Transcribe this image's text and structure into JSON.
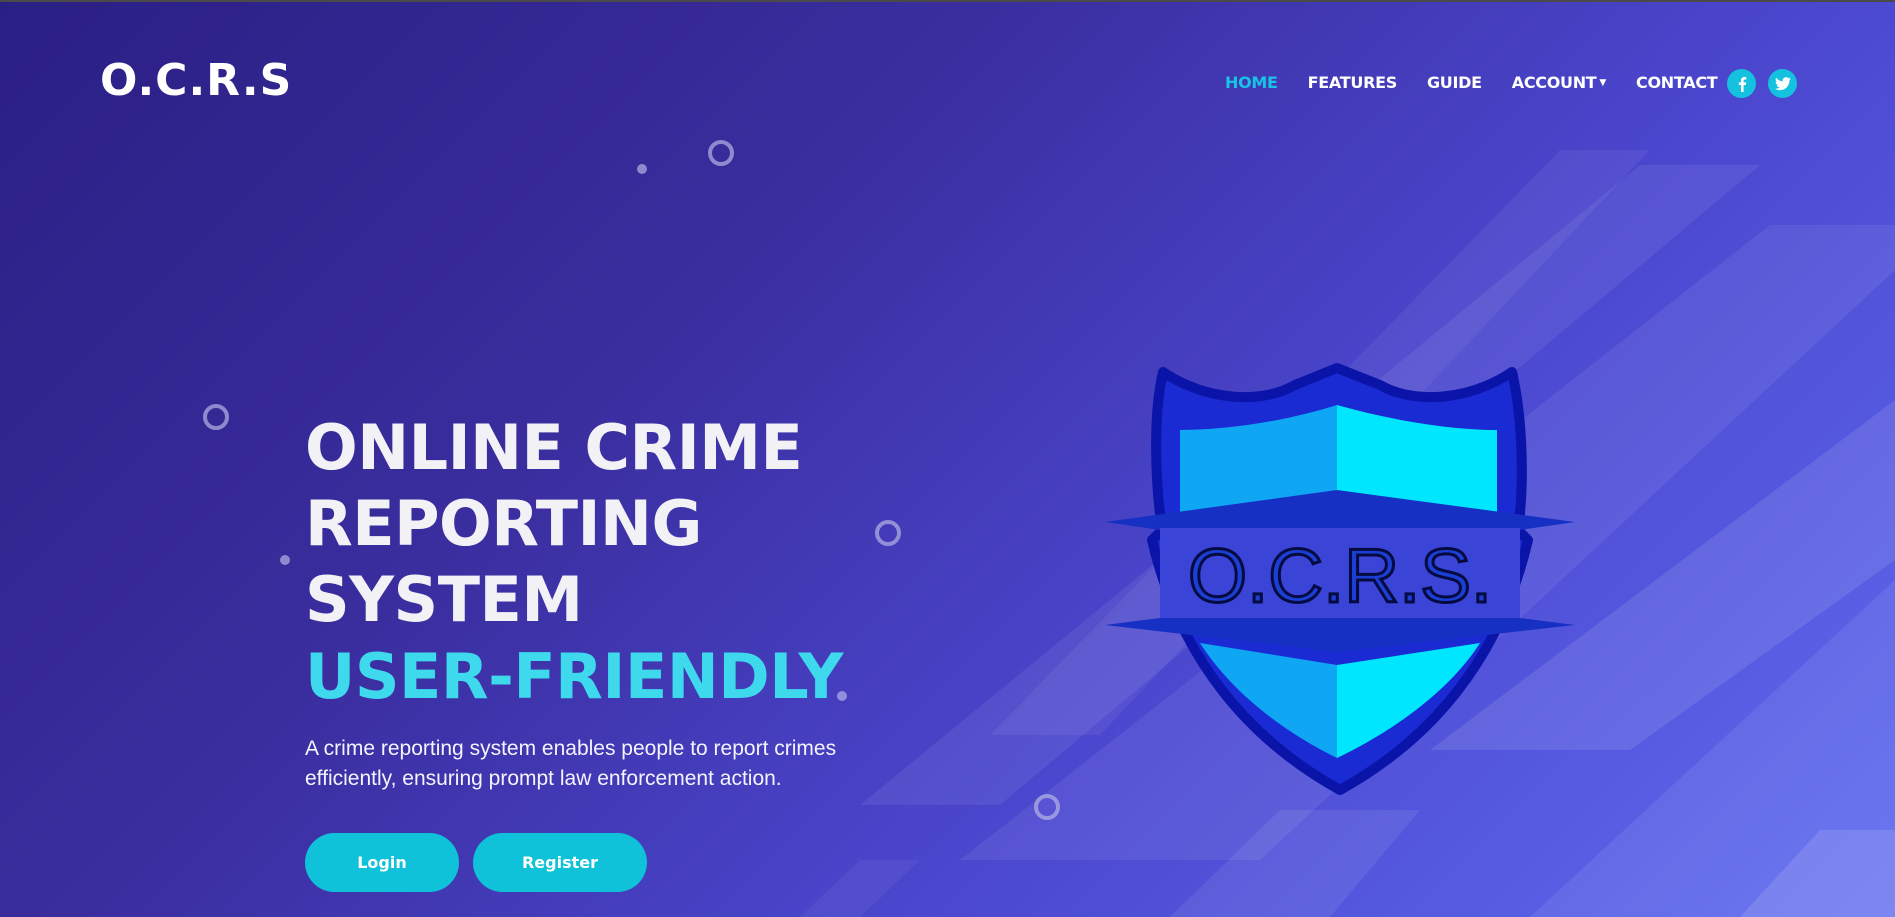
{
  "brand": {
    "name": "O.C.R.S"
  },
  "nav": {
    "items": [
      {
        "label": "HOME",
        "active": true
      },
      {
        "label": "FEATURES",
        "active": false
      },
      {
        "label": "GUIDE",
        "active": false
      },
      {
        "label": "ACCOUNT",
        "active": false,
        "dropdown": true
      },
      {
        "label": "CONTACT",
        "active": false
      }
    ],
    "socials": [
      {
        "icon": "facebook-icon",
        "glyph": "f"
      },
      {
        "icon": "twitter-icon",
        "glyph": "t"
      }
    ]
  },
  "hero": {
    "title_lines": [
      "ONLINE CRIME",
      "REPORTING",
      "SYSTEM"
    ],
    "highlight": "USER-FRIENDLY",
    "description": "A crime reporting system enables people to report crimes efficiently, ensuring prompt law enforcement action.",
    "login_label": "Login",
    "register_label": "Register"
  },
  "logo": {
    "text": "O.C.R.S.",
    "icon": "shield-icon"
  },
  "colors": {
    "accent": "#19c3e6",
    "button": "#0fc1d9",
    "highlight": "#3fd9ee",
    "background_start": "#2a1f84",
    "background_end": "#5f6cf0"
  }
}
